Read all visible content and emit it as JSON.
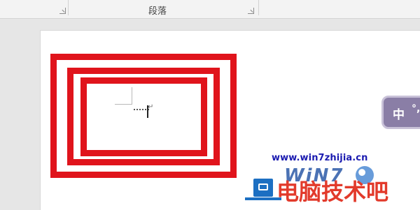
{
  "ribbon": {
    "paragraph_group_label": "段落"
  },
  "document": {
    "text_frames": 3,
    "frame_color": "#e0141c"
  },
  "ime": {
    "mode_char": "中",
    "punct": "°,"
  },
  "watermark": {
    "url": "www.win7zhijia.cn",
    "logo_text": "WiN7",
    "brand": "电脑技术吧"
  },
  "colors": {
    "accent_red": "#e0141c",
    "ime_purple": "#8a7ea6",
    "watermark_blue": "#1a1ab0",
    "watermark_red": "#e23a2b"
  }
}
